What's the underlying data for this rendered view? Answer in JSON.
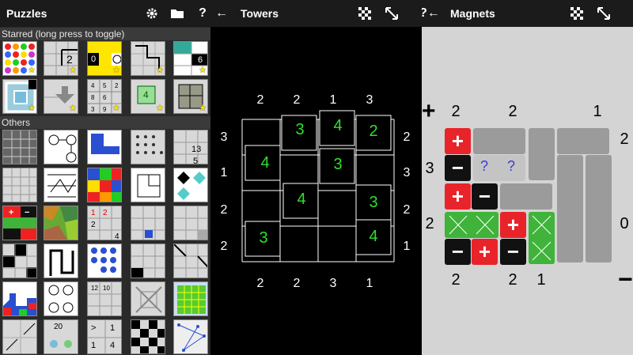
{
  "puzzles_panel": {
    "title": "Puzzles",
    "settings_icon": "gear-icon",
    "folder_icon": "folder-icon",
    "help_label": "?",
    "starred_header": "Starred (long press to toggle)",
    "others_header": "Others",
    "thumb_texts": {
      "sixes": "6",
      "twos": "2",
      "fours": "4",
      "twenty": "20",
      "tens": "10",
      "ones": "1"
    }
  },
  "towers_panel": {
    "back_icon": "back-arrow-icon",
    "title": "Towers",
    "menu_icon": "checker-icon",
    "fullscreen_icon": "fullscreen-icon",
    "top_clues": [
      "2",
      "2",
      "1",
      "3"
    ],
    "bottom_clues": [
      "2",
      "2",
      "3",
      "1"
    ],
    "left_clues": [
      "3",
      "1",
      "2",
      "2"
    ],
    "right_clues": [
      "2",
      "3",
      "2",
      "1"
    ],
    "towers": [
      "3",
      "4",
      "2",
      "4",
      "3",
      "4",
      "3",
      "3",
      "4"
    ]
  },
  "magnets_panel": {
    "help_back_label": "?←",
    "title": "Magnets",
    "menu_icon": "checker-icon",
    "fullscreen_icon": "fullscreen-icon",
    "plus_sign": "+",
    "minus_sign": "−",
    "top_clues": [
      "2",
      "2",
      "1"
    ],
    "right_clues": [
      "2",
      "0"
    ],
    "left_clues": [
      "3",
      "2"
    ],
    "bottom_clues": [
      "2",
      "2",
      "1"
    ],
    "question_marks": [
      "?",
      "?"
    ]
  }
}
